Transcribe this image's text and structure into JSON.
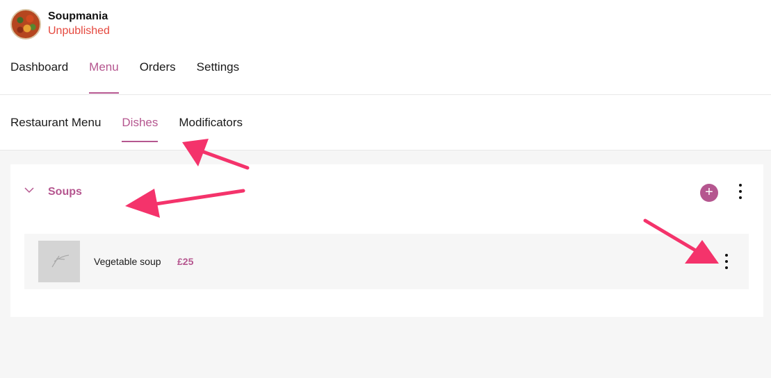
{
  "header": {
    "brand_name": "Soupmania",
    "brand_status": "Unpublished",
    "tabs": [
      {
        "label": "Dashboard"
      },
      {
        "label": "Menu",
        "active": true
      },
      {
        "label": "Orders"
      },
      {
        "label": "Settings"
      }
    ]
  },
  "subnav": {
    "tabs": [
      {
        "label": "Restaurant Menu"
      },
      {
        "label": "Dishes",
        "active": true
      },
      {
        "label": "Modificators"
      }
    ]
  },
  "category": {
    "title": "Soups",
    "add_icon": "+",
    "dishes": [
      {
        "name": "Vegetable soup",
        "price": "£25"
      }
    ]
  },
  "colors": {
    "accent": "#b5568f",
    "status_red": "#e5483e",
    "arrow": "#f4336b"
  },
  "icons": [
    "chevron-down-icon",
    "plus-icon",
    "more-vertical-icon",
    "image-placeholder-icon"
  ]
}
